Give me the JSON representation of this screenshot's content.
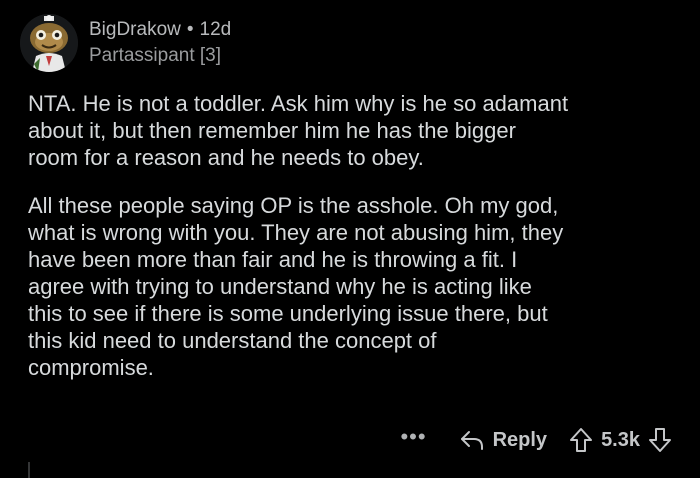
{
  "comment": {
    "author": "BigDrakow",
    "separator": "•",
    "age": "12d",
    "flair": "Partassipant [3]",
    "paragraphs": [
      "NTA. He is not a toddler. Ask him why is he so adamant\nabout it, but then remember him he has the bigger\nroom for a reason and he needs to obey.",
      "All these people saying OP is the asshole. Oh my god,\nwhat is wrong with you. They are not abusing him, they\nhave been more than fair and he is throwing a fit. I\nagree with trying to understand why he is acting like\nthis to see if there is some underlying issue there, but\nthis kid need to understand the concept of\ncompromise."
    ]
  },
  "actions": {
    "more_label": "•••",
    "reply_label": "Reply",
    "score": "5.3k"
  },
  "icons": {
    "avatar": "snoo-avatar-icon",
    "reply": "reply-arrow-icon",
    "upvote": "upvote-arrow-icon",
    "downvote": "downvote-arrow-icon"
  },
  "colors": {
    "background": "#000000",
    "text": "#d7dadc",
    "meta": "#b8babc"
  }
}
